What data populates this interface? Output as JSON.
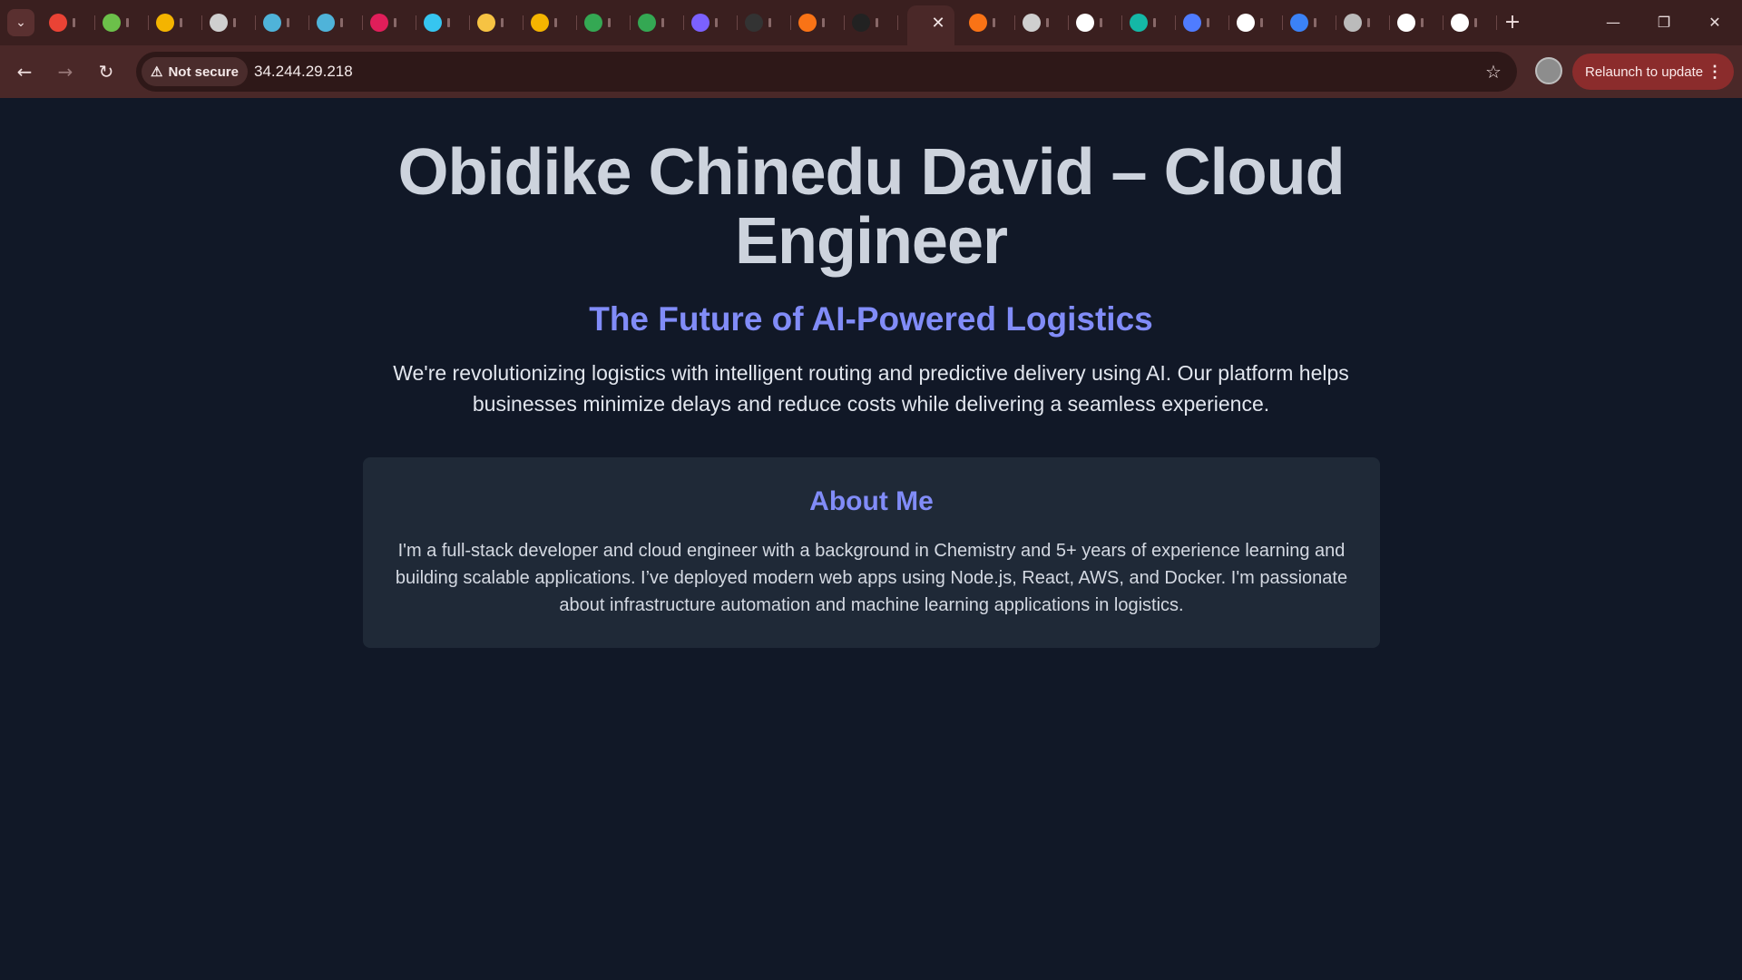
{
  "browser": {
    "address": "34.244.29.218",
    "security_label": "Not secure",
    "relaunch_label": "Relaunch to update",
    "tabs": [
      {
        "icon": "gmail-icon",
        "color": "#ea4335"
      },
      {
        "icon": "green-circle-icon",
        "color": "#6cc04a"
      },
      {
        "icon": "star-app-icon",
        "color": "#f4b400"
      },
      {
        "icon": "globe-icon",
        "color": "#cfcfcf"
      },
      {
        "icon": "google-chat-icon",
        "color": "#4fb3d9"
      },
      {
        "icon": "google-chat-icon",
        "color": "#4fb3d9"
      },
      {
        "icon": "slack-icon",
        "color": "#e01e5a"
      },
      {
        "icon": "slack-icon",
        "color": "#36c5f0"
      },
      {
        "icon": "yellow-ring-icon",
        "color": "#f6c343"
      },
      {
        "icon": "slides-icon",
        "color": "#f4b400"
      },
      {
        "icon": "drive-icon",
        "color": "#34a853"
      },
      {
        "icon": "drive-icon",
        "color": "#34a853"
      },
      {
        "icon": "purple-drop-icon",
        "color": "#7b61ff"
      },
      {
        "icon": "dark-app-icon",
        "color": "#333333"
      },
      {
        "icon": "orange-hex-icon",
        "color": "#f97316"
      },
      {
        "icon": "dark-circle-icon",
        "color": "#222222"
      },
      {
        "icon": "orange-square-icon",
        "color": "#f97316"
      },
      {
        "icon": "globe-icon",
        "color": "#cfcfcf"
      },
      {
        "icon": "github-icon",
        "color": "#ffffff"
      },
      {
        "icon": "teal-diamond-icon",
        "color": "#14b8a6"
      },
      {
        "icon": "grid-apps-icon",
        "color": "#4f7cff"
      },
      {
        "icon": "wikipedia-icon",
        "color": "#ffffff"
      },
      {
        "icon": "blue-swirl-icon",
        "color": "#3b82f6"
      },
      {
        "icon": "cloud-icon",
        "color": "#bbbbbb"
      },
      {
        "icon": "github-icon",
        "color": "#ffffff"
      },
      {
        "icon": "openai-icon",
        "color": "#ffffff"
      }
    ]
  },
  "page": {
    "title": "Obidike Chinedu David – Cloud Engineer",
    "subtitle": "The Future of AI-Powered Logistics",
    "lead": "We're revolutionizing logistics with intelligent routing and predictive delivery using AI. Our platform helps businesses minimize delays and reduce costs while delivering a seamless experience.",
    "about": {
      "heading": "About Me",
      "body": "I'm a full-stack developer and cloud engineer with a background in Chemistry and 5+ years of experience learning and building scalable applications. I’ve deployed modern web apps using Node.js, React, AWS, and Docker. I'm passionate about infrastructure automation and machine learning applications in logistics."
    }
  },
  "colors": {
    "page_bg": "#111827",
    "card_bg": "#1f2937",
    "accent": "#818cf8",
    "chrome": "#4a2828"
  }
}
